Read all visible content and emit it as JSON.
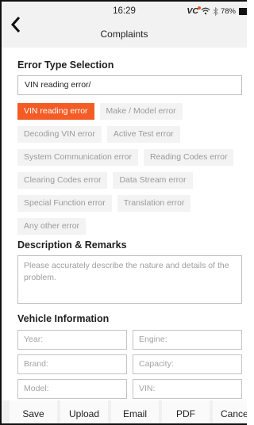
{
  "status": {
    "time": "16:29",
    "vc_label": "VC",
    "battery": "78%"
  },
  "header": {
    "title": "Complaints"
  },
  "error_type": {
    "heading": "Error Type Selection",
    "selected_value": "VIN reading error/",
    "chip_rows": [
      [
        {
          "label": "VIN reading error",
          "active": true
        },
        {
          "label": "Make / Model error",
          "active": false
        }
      ],
      [
        {
          "label": "Decoding VIN error",
          "active": false
        },
        {
          "label": "Active Test error",
          "active": false
        }
      ],
      [
        {
          "label": "System Communication error",
          "active": false
        },
        {
          "label": "Reading Codes error",
          "active": false
        }
      ],
      [
        {
          "label": "Clearing Codes error",
          "active": false
        },
        {
          "label": "Data Stream error",
          "active": false
        }
      ],
      [
        {
          "label": "Special Function error",
          "active": false
        },
        {
          "label": "Translation error",
          "active": false
        }
      ],
      [
        {
          "label": "Any other error",
          "active": false
        }
      ]
    ]
  },
  "description": {
    "heading": "Description & Remarks",
    "placeholder": "Please accurately describe the nature and details of the problem."
  },
  "vehicle": {
    "heading": "Vehicle Information",
    "year": "Year:",
    "engine": "Engine:",
    "brand": "Brand:",
    "capacity": "Capacity:",
    "model": "Model:",
    "vin": "VIN:"
  },
  "actions": {
    "save": "Save",
    "upload": "Upload",
    "email": "Email",
    "pdf": "PDF",
    "cancel": "Cancel"
  },
  "colors": {
    "accent": "#f35c24"
  }
}
